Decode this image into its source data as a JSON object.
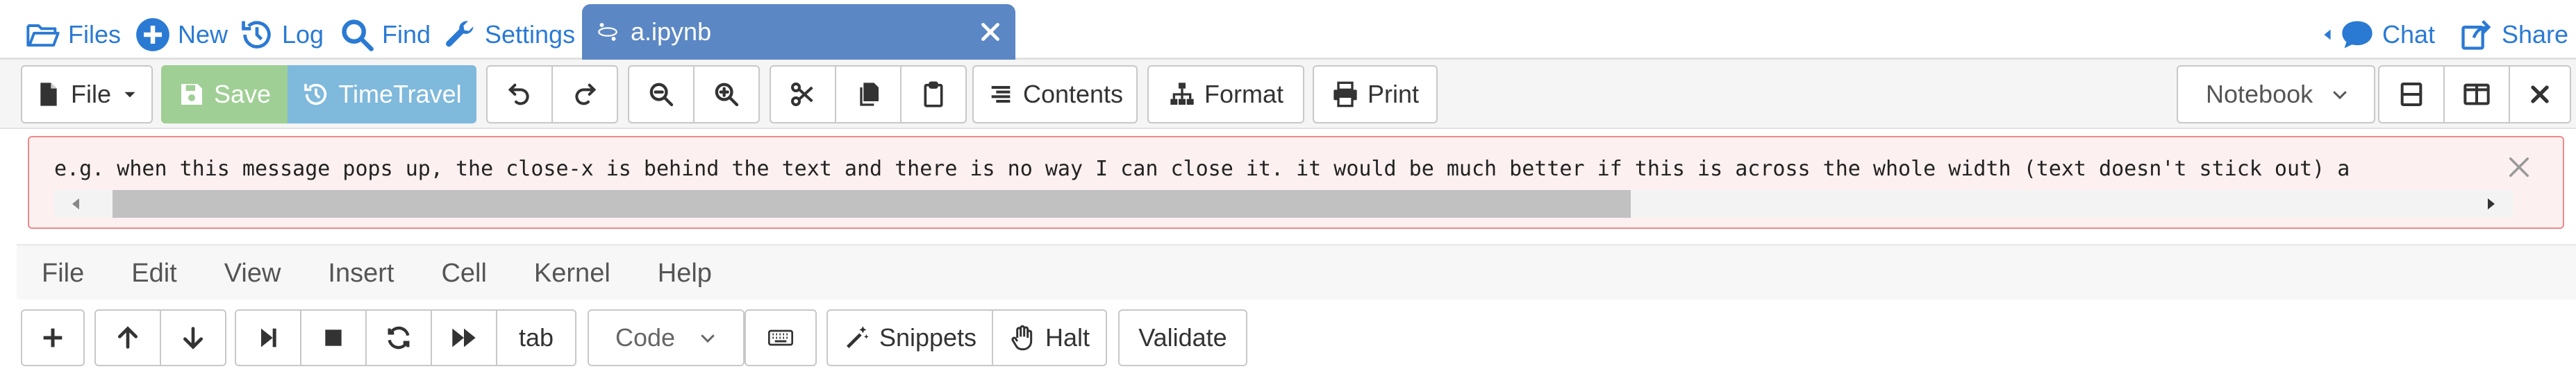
{
  "nav": {
    "files": "Files",
    "new": "New",
    "log": "Log",
    "find": "Find",
    "settings": "Settings",
    "chat": "Chat",
    "share": "Share"
  },
  "tab": {
    "filename": "a.ipynb"
  },
  "toolbar": {
    "file": "File",
    "save": "Save",
    "timetravel": "TimeTravel",
    "contents": "Contents",
    "format": "Format",
    "print": "Print",
    "view_mode": "Notebook"
  },
  "alert": {
    "message": "e.g. when this message pops up, the close-x is behind the text and there is no way I can close it. it would be much better if this is across the whole width (text doesn't stick out) a"
  },
  "menubar": [
    "File",
    "Edit",
    "View",
    "Insert",
    "Cell",
    "Kernel",
    "Help"
  ],
  "celltoolbar": {
    "tab": "tab",
    "cell_type": "Code",
    "snippets": "Snippets",
    "halt": "Halt",
    "validate": "Validate"
  },
  "colors": {
    "link": "#2a7ad4",
    "tab_active": "#5b87c4",
    "save_bg": "#9fcf94",
    "timetravel_bg": "#7fb9dc",
    "alert_bg": "#fdf0f0",
    "alert_border": "#ee8a8a"
  }
}
